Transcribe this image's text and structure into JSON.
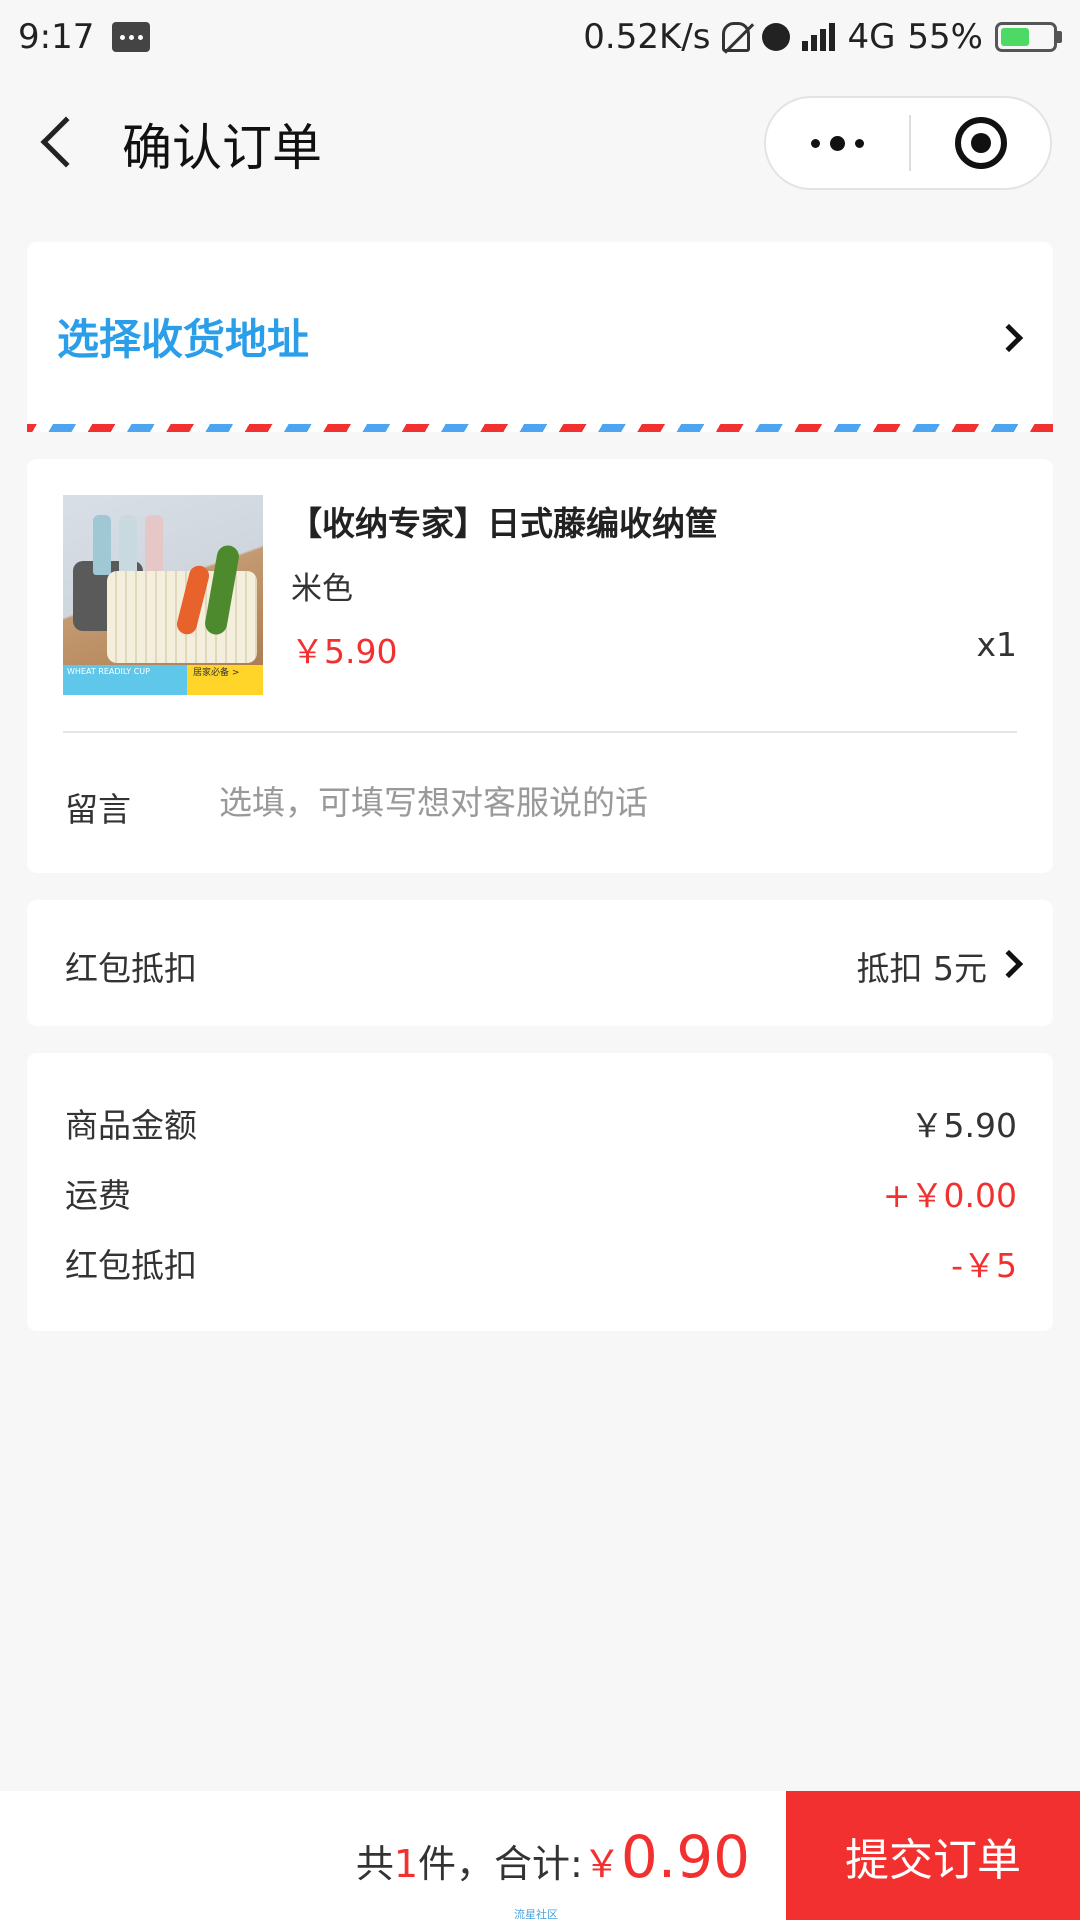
{
  "status_bar": {
    "time": "9:17",
    "network_speed": "0.52K/s",
    "network_type": "4G",
    "battery": "55%",
    "battery_level": 0.55,
    "icons": [
      "message-icon",
      "mute-bell-icon",
      "alarm-icon",
      "signal-icon",
      "battery-icon"
    ]
  },
  "nav": {
    "title": "确认订单",
    "icons": [
      "back-icon",
      "more-icon",
      "close-target-icon"
    ]
  },
  "address": {
    "label": "选择收货地址",
    "accent_color": "#2b9ee9"
  },
  "goods": {
    "title": "【收纳专家】日式藤编收纳筐",
    "spec": "米色",
    "price": "￥5.90",
    "quantity": "x1",
    "image_banner_left": "WHEAT READILY CUP",
    "image_banner_right": "居家必备 >"
  },
  "memo": {
    "label": "留言",
    "placeholder": "选填，可填写想对客服说的话"
  },
  "coupon": {
    "label": "红包抵扣",
    "value": "抵扣 5元"
  },
  "summary": {
    "rows": [
      {
        "label": "商品金额",
        "value": "￥5.90"
      },
      {
        "label": "运费",
        "value": "+￥0.00"
      },
      {
        "label": "红包抵扣",
        "value": "-￥5"
      }
    ]
  },
  "bottom": {
    "count_prefix": "共",
    "count": "1",
    "count_suffix": "件，合计:",
    "currency": "￥",
    "total": "0.90",
    "submit_label": "提交订单",
    "watermark": "流星社区"
  },
  "colors": {
    "price_red": "#f23030",
    "background": "#f7f7f7"
  }
}
